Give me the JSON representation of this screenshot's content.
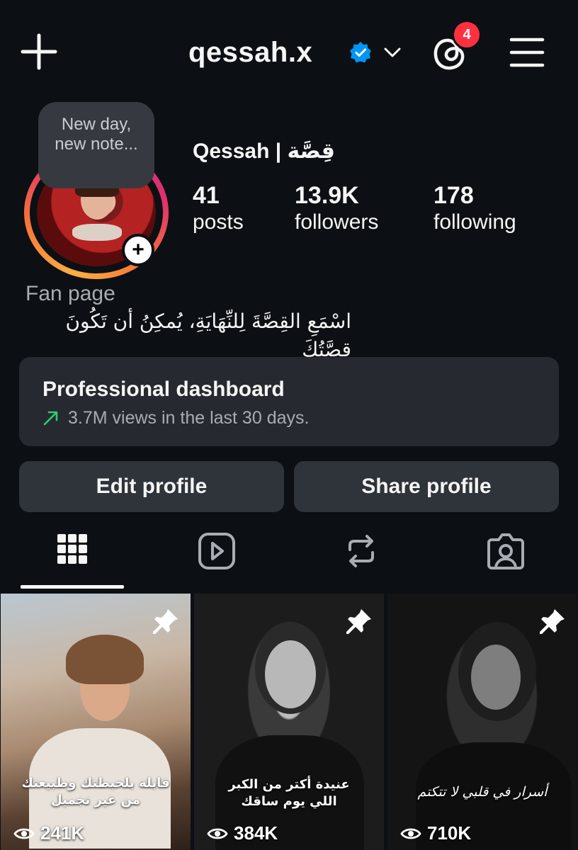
{
  "header": {
    "username": "qessah.x",
    "notification_count": "4",
    "icons": [
      "plus-icon",
      "verified-icon",
      "chevron-down-icon",
      "threads-icon",
      "menu-icon"
    ]
  },
  "profile": {
    "note": "New day, new note...",
    "display_name": "Qessah | قِصَّة",
    "stats": [
      {
        "value": "41",
        "label": "posts"
      },
      {
        "value": "13.9K",
        "label": "followers"
      },
      {
        "value": "178",
        "label": "following"
      }
    ],
    "category": "Fan page",
    "bio": "اسْمَعِ القِصَّةَ لِلنِّهَايَةِ، يُمكِنُ أن تَكُونَ قِصَّتُكَ"
  },
  "dashboard": {
    "title": "Professional dashboard",
    "subtitle": "3.7M views in the last 30 days."
  },
  "buttons": {
    "edit": "Edit profile",
    "share": "Share profile"
  },
  "tabs": [
    "grid-icon",
    "reels-icon",
    "reposts-icon",
    "tagged-icon"
  ],
  "posts": [
    {
      "caption_line1": "قابلة بلخبطتك وطبيعتك",
      "caption_line2": "من غير تجميل",
      "views": "241K",
      "pinned": true
    },
    {
      "caption_line1": "عنيدة أكتر من الكبر",
      "caption_line2": "اللي يوم ساقك",
      "views": "384K",
      "pinned": true
    },
    {
      "caption_line1": "أسرار في قلبي لا تتكتم",
      "caption_line2": "",
      "views": "710K",
      "pinned": true
    }
  ],
  "colors": {
    "background": "#0c1014",
    "card": "#262a30",
    "button": "#2f333a",
    "badge": "#ff3040",
    "verified": "#0095f6",
    "trend_arrow": "#2ecc71"
  }
}
